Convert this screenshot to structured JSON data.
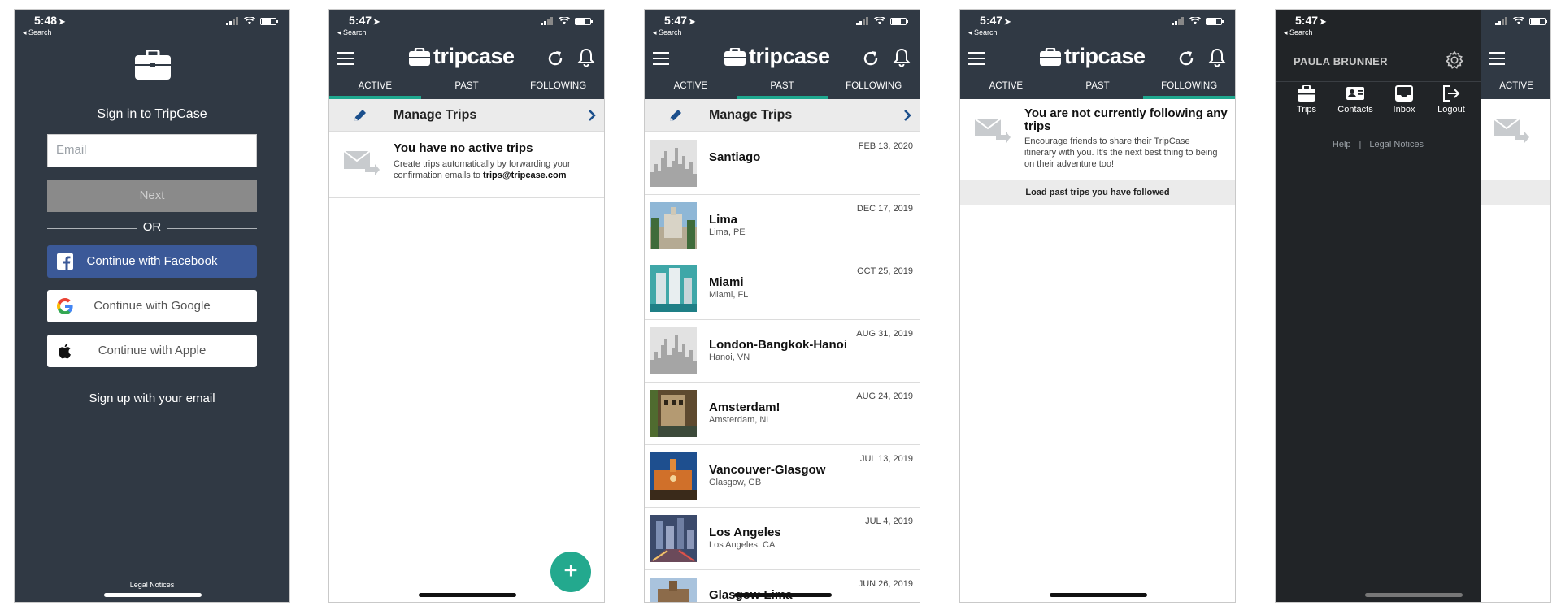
{
  "colors": {
    "header": "#303944",
    "accent": "#1fa88f",
    "facebook": "#3b5998",
    "drawer": "#212427"
  },
  "signin": {
    "status_time": "5:48",
    "status_back": "◂ Search",
    "title": "Sign in to TripCase",
    "email_placeholder": "Email",
    "next_label": "Next",
    "or_label": "OR",
    "facebook_label": "Continue with Facebook",
    "google_label": "Continue with Google",
    "apple_label": "Continue with Apple",
    "signup_label": "Sign up with your email",
    "legal_label": "Legal Notices"
  },
  "app": {
    "status_time": "5:47",
    "status_back": "◂ Search",
    "logo_text": "tripcase",
    "tabs": [
      "ACTIVE",
      "PAST",
      "FOLLOWING"
    ],
    "manage_trips_label": "Manage Trips"
  },
  "active_screen": {
    "empty_title": "You have no active trips",
    "empty_desc_prefix": "Create trips automatically by forwarding your confirmation emails to ",
    "empty_desc_email": "trips@tripcase.com",
    "fab_label": "+"
  },
  "past_trips": [
    {
      "name": "Santiago",
      "location": "",
      "date": "FEB 13, 2020",
      "thumb": "skyline-placeholder"
    },
    {
      "name": "Lima",
      "location": "Lima, PE",
      "date": "DEC 17, 2019",
      "thumb": "lima-photo"
    },
    {
      "name": "Miami",
      "location": "Miami, FL",
      "date": "OCT 25, 2019",
      "thumb": "miami-photo"
    },
    {
      "name": "London-Bangkok-Hanoi",
      "location": "Hanoi, VN",
      "date": "AUG 31, 2019",
      "thumb": "skyline-placeholder"
    },
    {
      "name": "Amsterdam!",
      "location": "Amsterdam, NL",
      "date": "AUG 24, 2019",
      "thumb": "amsterdam-photo"
    },
    {
      "name": "Vancouver-Glasgow",
      "location": "Glasgow, GB",
      "date": "JUL 13, 2019",
      "thumb": "glasgow-photo"
    },
    {
      "name": "Los Angeles",
      "location": "Los Angeles, CA",
      "date": "JUL 4, 2019",
      "thumb": "la-photo"
    },
    {
      "name": "Glasgow-Lima",
      "location": "",
      "date": "JUN 26, 2019",
      "thumb": "glasgow2-photo"
    }
  ],
  "following_screen": {
    "title": "You are not currently following any trips",
    "desc": "Encourage friends to share their TripCase itinerary with you. It's the next best thing to being on their adventure too!",
    "load_past_label": "Load past trips you have followed"
  },
  "drawer": {
    "user_name": "PAULA BRUNNER",
    "nav": [
      "Trips",
      "Contacts",
      "Inbox",
      "Logout"
    ],
    "help_label": "Help",
    "separator": "|",
    "legal_label": "Legal Notices",
    "under_tab": "ACTIVE"
  }
}
